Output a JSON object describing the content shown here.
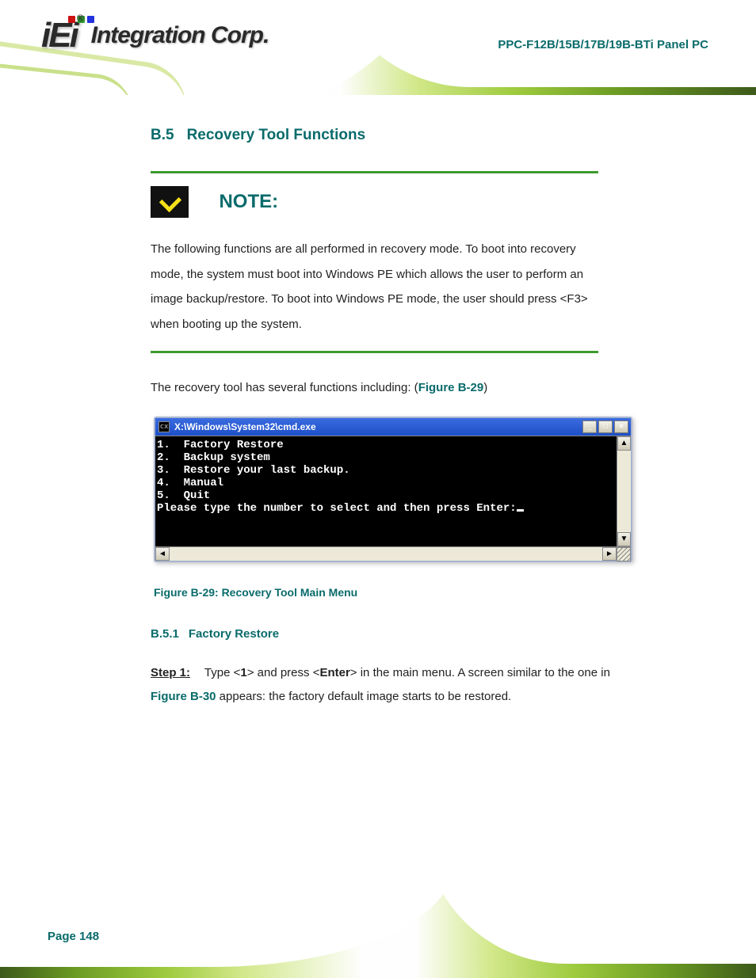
{
  "brand": {
    "logo_mark": "iEi",
    "registered": "®",
    "logo_text": "Integration Corp."
  },
  "header": {
    "product_title": "PPC-F12B/15B/17B/19B-BTi Panel PC"
  },
  "section": {
    "number": "B.5",
    "title": "Recovery Tool Functions"
  },
  "note": {
    "title": "NOTE:",
    "text": "The following functions are all performed in recovery mode. To boot into recovery mode, the system must boot into Windows PE which allows the user to perform an image backup/restore. To boot into Windows PE mode, the user should press <F3> when booting up the system."
  },
  "intro_text_before": "The recovery tool has several functions including:",
  "intro_figref": "Figure B-29",
  "cmd": {
    "title": "X:\\Windows\\System32\\cmd.exe",
    "title_icon": "cx",
    "lines": [
      "1.  Factory Restore",
      "2.  Backup system",
      "3.  Restore your last backup.",
      "4.  Manual",
      "5.  Quit",
      "Please type the number to select and then press Enter:"
    ],
    "min": "_",
    "max": "□",
    "close": "×",
    "up": "▲",
    "down": "▼",
    "left": "◄",
    "right": "►"
  },
  "figure_caption": "Figure B-29: Recovery Tool Main Menu",
  "subsection": {
    "number": "B.5.1",
    "title": "Factory Restore"
  },
  "step": {
    "label": "Step 1:",
    "before_kbd": "Type <",
    "kbd": "1",
    "after_kbd": "> and press <",
    "kbd2": "Enter",
    "tail": "> in the main menu.",
    "sentence2_before": "A screen similar to the one in ",
    "figref": "Figure B-30",
    "sentence2_after": " appears: the factory default image starts to be restored."
  },
  "footer": {
    "page_label": "Page 148"
  }
}
